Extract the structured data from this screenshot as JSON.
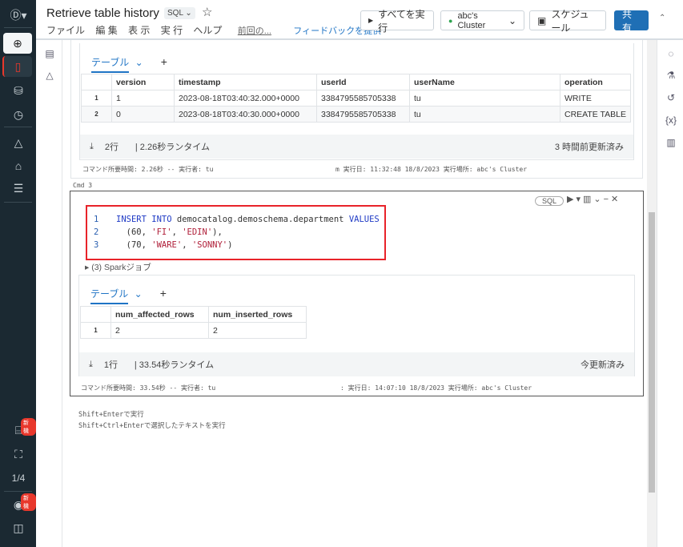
{
  "header": {
    "title": "Retrieve table history",
    "lang": "SQL",
    "menu": [
      "ファイル",
      "編 集",
      "表 示",
      "実 行",
      "ヘルプ"
    ],
    "last_edit": "前回の...",
    "feedback": "フィードバックを提供",
    "run_all": "すべてを実行",
    "cluster": "abc's Cluster",
    "schedule": "スケジュール",
    "share": "共 有"
  },
  "sidebar": {
    "page": "1/4",
    "new_badge": "新機"
  },
  "cell2": {
    "tab": "テーブル",
    "columns": [
      "version",
      "timestamp",
      "userId",
      "userName",
      "operation"
    ],
    "rows": [
      [
        "1",
        "1",
        "2023-08-18T03:40:32.000+0000",
        "3384795585705338",
        "tu",
        "WRITE"
      ],
      [
        "2",
        "0",
        "2023-08-18T03:40:30.000+0000",
        "3384795585705338",
        "tu",
        "CREATE TABLE"
      ]
    ],
    "row_count": "2行",
    "runtime": "| 2.26秒ランタイム",
    "updated": "3 時間前更新済み",
    "info_left": "コマンド所要時間: 2.26秒 -- 実行者: tu",
    "info_right": "m 実行日: 11:32:48 18/8/2023 実行場所: abc's Cluster"
  },
  "cell3": {
    "label": "Cmd 3",
    "lang": "SQL",
    "code": {
      "l1": "1",
      "l2": "2",
      "l3": "3",
      "insert": "INSERT INTO",
      "table": " democatalog.demoschema.department ",
      "values": "VALUES",
      "r1a": "(60, ",
      "r1b": "'FI'",
      "r1c": ", ",
      "r1d": "'EDIN'",
      "r1e": "),",
      "r2a": "(70, ",
      "r2b": "'WARE'",
      "r2c": ", ",
      "r2d": "'SONNY'",
      "r2e": ")"
    },
    "spark": "(3) Sparkジョブ",
    "tab": "テーブル",
    "columns": [
      "num_affected_rows",
      "num_inserted_rows"
    ],
    "rows": [
      [
        "1",
        "2",
        "2"
      ]
    ],
    "row_count": "1行",
    "runtime": "| 33.54秒ランタイム",
    "updated": "今更新済み",
    "info_left": "コマンド所要時間: 33.54秒 -- 実行者: tu",
    "info_right": ": 実行日: 14:07:10 18/8/2023 実行場所: abc's Cluster"
  },
  "hints": [
    "Shift+Enterで実行",
    "Shift+Ctrl+Enterで選択したテキストを実行"
  ],
  "colors": {
    "nav": "#1b2932",
    "accent": "#1f74c5",
    "highlight": "#e8382c"
  }
}
